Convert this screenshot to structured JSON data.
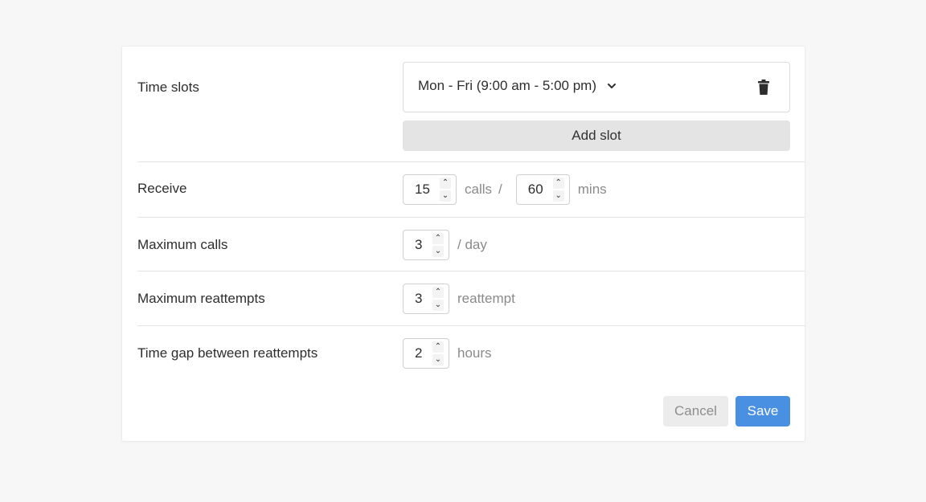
{
  "time_slots": {
    "label": "Time slots",
    "selected_slot": "Mon - Fri (9:00 am - 5:00 pm)",
    "chevron_icon": "chevron-down-icon",
    "delete_icon": "trash-icon",
    "add_slot_label": "Add slot"
  },
  "receive": {
    "label": "Receive",
    "calls_value": "15",
    "calls_unit": "calls",
    "separator": "/",
    "mins_value": "60",
    "mins_unit": "mins"
  },
  "maximum_calls": {
    "label": "Maximum calls",
    "value": "3",
    "unit": "/ day"
  },
  "maximum_reattempts": {
    "label": "Maximum reattempts",
    "value": "3",
    "unit": "reattempt"
  },
  "time_gap": {
    "label": "Time gap between reattempts",
    "value": "2",
    "unit": "hours"
  },
  "actions": {
    "cancel_label": "Cancel",
    "save_label": "Save"
  },
  "colors": {
    "primary": "#4a90e2",
    "secondary_button": "#ececec",
    "unit_text": "#8a8a8a"
  }
}
